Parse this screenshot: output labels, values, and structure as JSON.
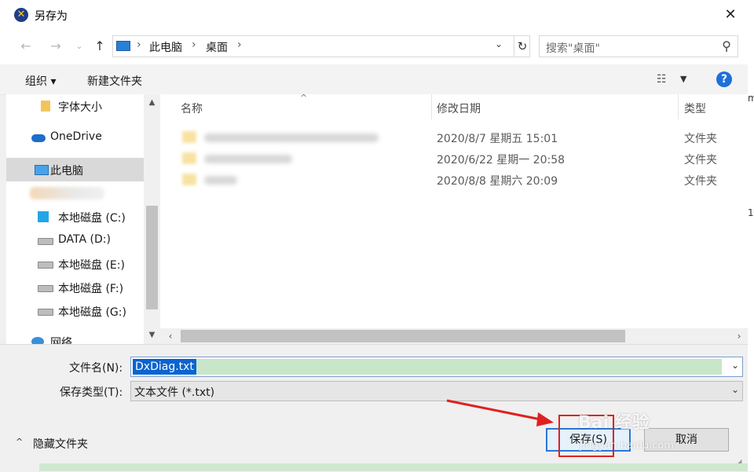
{
  "window": {
    "title": "另存为"
  },
  "address": {
    "crumbs": [
      "此电脑",
      "桌面"
    ],
    "search_placeholder": "搜索\"桌面\""
  },
  "toolbar": {
    "organize": "组织 ▾",
    "new_folder": "新建文件夹",
    "help": "?"
  },
  "nav": {
    "items": [
      {
        "label": "字体大小",
        "icon": "folder-icon"
      },
      {
        "label": "OneDrive",
        "icon": "cloud-icon"
      },
      {
        "label": "此电脑",
        "icon": "computer-icon",
        "selected": true
      },
      {
        "label": "",
        "icon": "blurred"
      },
      {
        "label": "本地磁盘 (C:)",
        "icon": "windows-drive-icon"
      },
      {
        "label": "DATA (D:)",
        "icon": "drive-icon"
      },
      {
        "label": "本地磁盘 (E:)",
        "icon": "drive-icon"
      },
      {
        "label": "本地磁盘 (F:)",
        "icon": "drive-icon"
      },
      {
        "label": "本地磁盘 (G:)",
        "icon": "drive-icon"
      },
      {
        "label": "网络",
        "icon": "network-icon"
      }
    ]
  },
  "filelist": {
    "columns": {
      "name": "名称",
      "date": "修改日期",
      "type": "类型"
    },
    "rows": [
      {
        "date": "2020/8/7 星期五 15:01",
        "type": "文件夹"
      },
      {
        "date": "2020/6/22 星期一 20:58",
        "type": "文件夹"
      },
      {
        "date": "2020/8/8 星期六 20:09",
        "type": "文件夹"
      }
    ]
  },
  "form": {
    "filename_label": "文件名(N):",
    "filename_value": "DxDiag.txt",
    "filetype_label": "保存类型(T):",
    "filetype_value": "文本文件 (*.txt)"
  },
  "footer": {
    "hide_folders": "隐藏文件夹",
    "save": "保存(S)",
    "cancel": "取消"
  },
  "watermark": {
    "brand": "Bai 经验",
    "url": "jingyan.baidu.com"
  },
  "colors": {
    "selection": "#0a64d0",
    "highlight_box": "#e02020",
    "arrow": "#e02020",
    "filename_fill": "#c8e6c9"
  }
}
